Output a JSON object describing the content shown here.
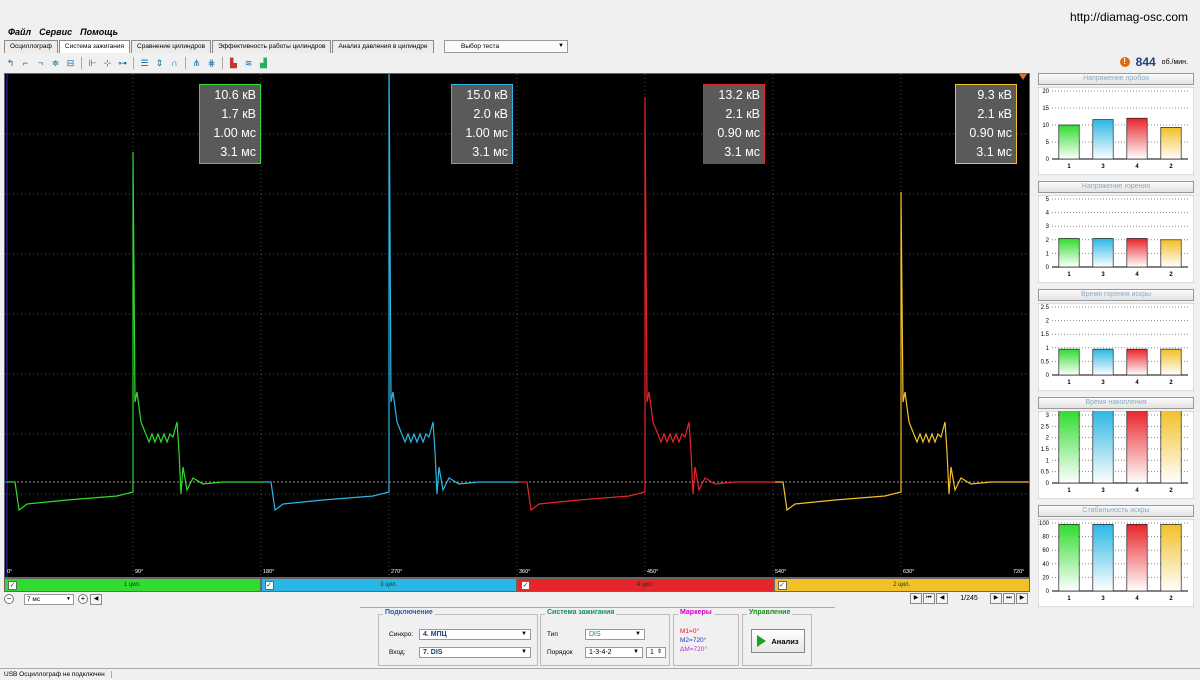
{
  "site_url": "http://diamag-osc.com",
  "menu": [
    "Файл",
    "Сервис",
    "Помощь"
  ],
  "tabs": [
    "Осциллограф",
    "Система зажигания",
    "Сравнение цилиндров",
    "Эффективность работы цилиндров",
    "Анализ давления в цилиндре"
  ],
  "active_tab": 1,
  "test_select": {
    "label": "Выбор теста"
  },
  "rpm": {
    "value": "844",
    "unit": "об./мин."
  },
  "cylinders": [
    {
      "label": "1 цил.",
      "color": "#2fdc2f",
      "meas": [
        "10.6 кВ",
        "1.7 кВ",
        "1.00 мс",
        "3.1 мс"
      ]
    },
    {
      "label": "3 цил.",
      "color": "#2bb7e6",
      "meas": [
        "15.0 кВ",
        "2.0 кВ",
        "1.00 мс",
        "3.1 мс"
      ]
    },
    {
      "label": "4 цил.",
      "color": "#e8242b",
      "meas": [
        "13.2 кВ",
        "2.1 кВ",
        "0.90 мс",
        "3.1 мс"
      ]
    },
    {
      "label": "2 цил.",
      "color": "#f2c027",
      "meas": [
        "9.3 кВ",
        "2.1 кВ",
        "0.90 мс",
        "3.1 мс"
      ]
    }
  ],
  "degree_labels": [
    "0°",
    "90°",
    "180°",
    "270°",
    "360°",
    "450°",
    "540°",
    "630°",
    "720°"
  ],
  "time_scale": "7 мс",
  "pager": {
    "text": "1/245"
  },
  "side_charts": [
    {
      "title": "Напряжение пробоя",
      "categories": [
        "1",
        "3",
        "4",
        "2"
      ],
      "values": [
        10,
        11.6,
        12,
        9.3
      ],
      "ticks": [
        0,
        5,
        10,
        15,
        20
      ]
    },
    {
      "title": "Напряжение горения",
      "categories": [
        "1",
        "3",
        "4",
        "2"
      ],
      "values": [
        2.1,
        2.1,
        2.1,
        2.0
      ],
      "ticks": [
        0,
        1,
        2,
        3,
        4,
        5
      ]
    },
    {
      "title": "Время горения искры",
      "categories": [
        "1",
        "3",
        "4",
        "2"
      ],
      "values": [
        0.95,
        0.95,
        0.95,
        0.95
      ],
      "ticks": [
        0,
        0.5,
        1,
        1.5,
        2,
        2.5
      ]
    },
    {
      "title": "Время накопления",
      "categories": [
        "1",
        "3",
        "4",
        "2"
      ],
      "values": [
        3.2,
        3.2,
        3.2,
        3.2
      ],
      "ticks": [
        0,
        0.5,
        1,
        1.5,
        2,
        2.5,
        3
      ]
    },
    {
      "title": "Стабильность искры",
      "categories": [
        "1",
        "3",
        "4",
        "2"
      ],
      "values": [
        98,
        98,
        98,
        98
      ],
      "ticks": [
        0,
        20,
        40,
        60,
        80,
        100
      ]
    }
  ],
  "connection": {
    "title": "Подключение",
    "sync_label": "Синхро:",
    "sync_value": "4.  МПЦ",
    "input_label": "Вход:",
    "input_value": "7.  DIS"
  },
  "ignition": {
    "title": "Система зажигания",
    "type_label": "Тип",
    "type_value": "DIS",
    "order_label": "Порядок",
    "order_value": "1-3-4-2",
    "order_num": "1"
  },
  "markers": {
    "title": "Маркеры",
    "m1": "M1=0°",
    "m2": "M2=720°",
    "dm": "ΔM=720°"
  },
  "control": {
    "title": "Управление",
    "button": "Анализ"
  },
  "status": "USB Осциллограф не подключен"
}
